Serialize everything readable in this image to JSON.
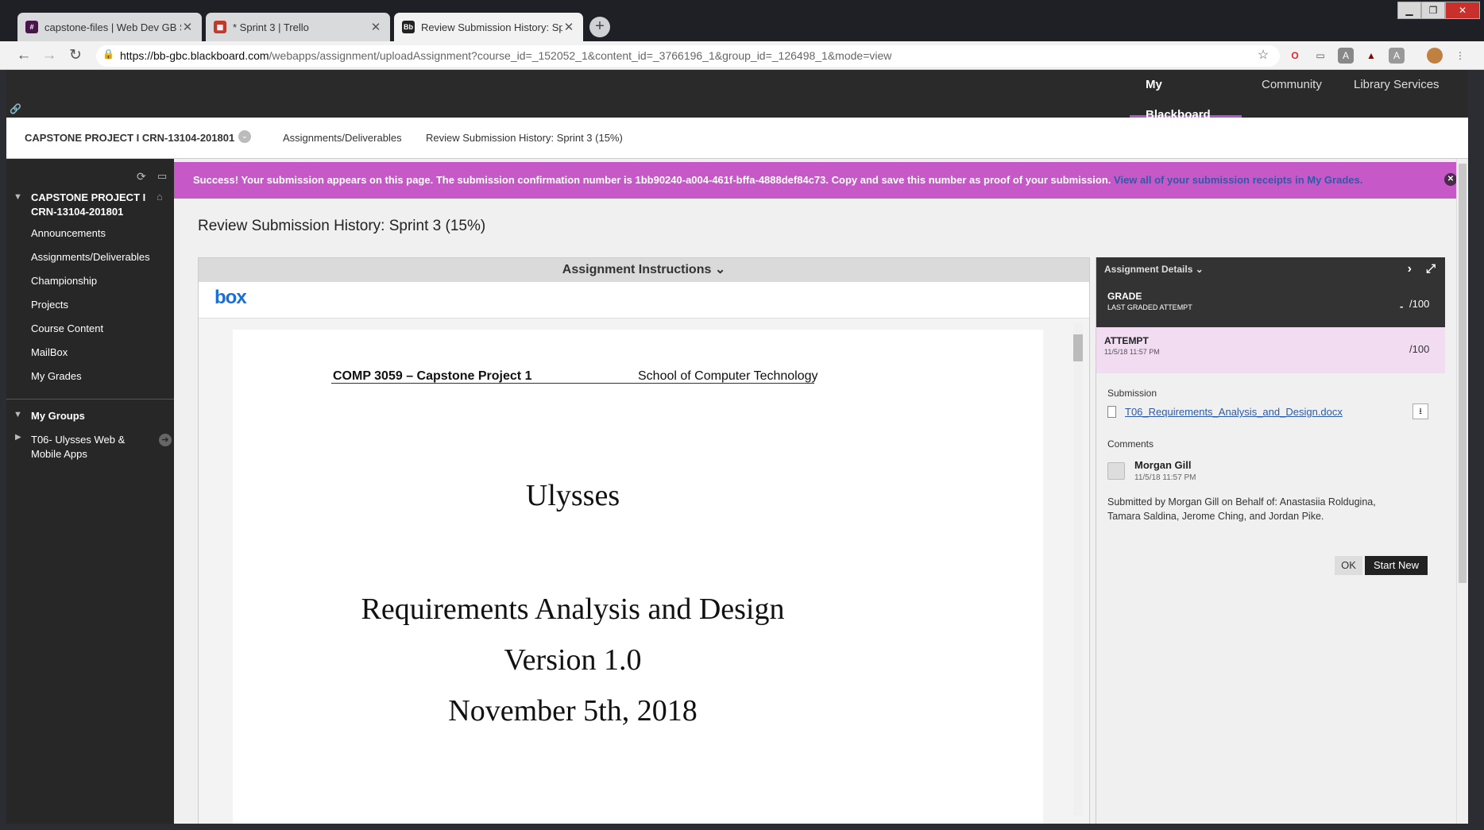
{
  "browser": {
    "tabs": [
      {
        "title": "capstone-files | Web Dev GB Slac",
        "favicon": "slack-icon"
      },
      {
        "title": "* Sprint 3 | Trello",
        "favicon": "trello-icon"
      },
      {
        "title": "Review Submission History: Sprin",
        "favicon": "blackboard-icon"
      }
    ],
    "url_host": "https://bb-gbc.blackboard.com",
    "url_path": "/webapps/assignment/uploadAssignment?course_id=_152052_1&content_id=_3766196_1&group_id=_126498_1&mode=view"
  },
  "topnav": {
    "items": [
      "My Blackboard",
      "Community",
      "Library Services"
    ],
    "active": "My Blackboard"
  },
  "breadcrumb": {
    "course": "CAPSTONE PROJECT I CRN-13104-201801",
    "items": [
      "Assignments/Deliverables",
      "Review Submission History: Sprint 3 (15%)"
    ]
  },
  "sidebar": {
    "course_title_line1": "CAPSTONE PROJECT I",
    "course_title_line2": "CRN-13104-201801",
    "items": [
      "Announcements",
      "Assignments/Deliverables",
      "Championship",
      "Projects",
      "Course Content",
      "MailBox",
      "My Grades"
    ],
    "groups_heading": "My Groups",
    "group_line1": "T06- Ulysses Web &",
    "group_line2": "Mobile Apps"
  },
  "banner": {
    "message": "Success! Your submission appears on this page. The submission confirmation number is 1bb90240-a004-461f-bffa-4888def84c73. Copy and save this number as proof of your submission.",
    "link": "View all of your submission receipts in My Grades."
  },
  "page_title": "Review Submission History: Sprint 3 (15%)",
  "viewer": {
    "header": "Assignment Instructions",
    "logo": "box",
    "doc_header_left": "COMP 3059 – Capstone Project 1",
    "doc_header_right": "School of Computer Technology",
    "doc_title": "Ulysses",
    "doc_subtitle": "Requirements Analysis and Design",
    "doc_version": "Version 1.0",
    "doc_date": "November 5th, 2018"
  },
  "details": {
    "header": "Assignment Details",
    "grade_label": "GRADE",
    "grade_sub": "LAST GRADED ATTEMPT",
    "grade_value": "-",
    "grade_out_of": "/100",
    "attempt_label": "ATTEMPT",
    "attempt_date": "11/5/18 11:57 PM",
    "attempt_out_of": "/100",
    "submission_label": "Submission",
    "file_name": "T06_Requirements_Analysis_and_Design.docx",
    "comments_label": "Comments",
    "commenter": "Morgan Gill",
    "comment_date": "11/5/18 11:57 PM",
    "comment_line1": "Submitted by Morgan Gill on Behalf of: Anastasiia Roldugina,",
    "comment_line2": "Tamara Saldina, Jerome Ching, and Jordan Pike.",
    "ok_label": "OK",
    "start_new_label": "Start New"
  },
  "colors": {
    "banner": "#c758c8",
    "topnav": "#2a2a2a",
    "sidebar": "#272727",
    "accent": "#a45ebf",
    "attempt_bg": "#f2dcf2",
    "link": "#2e5ba8"
  }
}
